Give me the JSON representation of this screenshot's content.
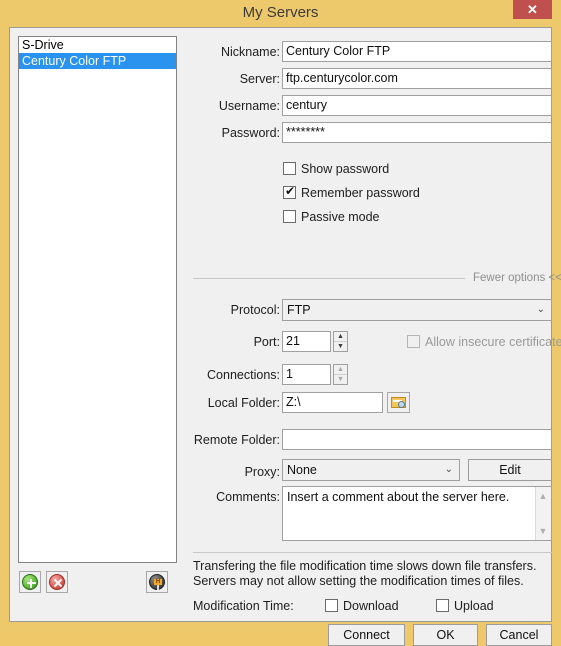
{
  "window": {
    "title": "My Servers",
    "close_label": "✕"
  },
  "server_list": {
    "items": [
      {
        "label": "S-Drive",
        "selected": false
      },
      {
        "label": "Century Color FTP",
        "selected": true
      }
    ]
  },
  "list_toolbar": {
    "add_tooltip": "Add",
    "delete_tooltip": "Delete",
    "options_tooltip": "Options"
  },
  "form": {
    "nickname": {
      "label": "Nickname:",
      "value": "Century Color FTP"
    },
    "server": {
      "label": "Server:",
      "value": "ftp.centurycolor.com"
    },
    "username": {
      "label": "Username:",
      "value": "century"
    },
    "password": {
      "label": "Password:",
      "value": "********"
    },
    "show_password": {
      "label": "Show password",
      "checked": false
    },
    "remember_password": {
      "label": "Remember password",
      "checked": true
    },
    "passive_mode": {
      "label": "Passive mode",
      "checked": false
    },
    "fewer_options": "Fewer options  <<",
    "protocol": {
      "label": "Protocol:",
      "value": "FTP"
    },
    "port": {
      "label": "Port:",
      "value": "21"
    },
    "allow_insecure_certificates": {
      "label": "Allow insecure certificates",
      "checked": false,
      "disabled": true
    },
    "connections": {
      "label": "Connections:",
      "value": "1"
    },
    "local_folder": {
      "label": "Local Folder:",
      "value": "Z:\\"
    },
    "browse_icon": "folder-browse-icon",
    "remote_folder": {
      "label": "Remote Folder:",
      "value": ""
    },
    "proxy": {
      "label": "Proxy:",
      "value": "None",
      "edit_label": "Edit"
    },
    "comments": {
      "label": "Comments:",
      "value": "Insert a comment about the server here."
    }
  },
  "footer": {
    "note": "Transfering the file modification time slows down file transfers. Servers may not allow setting the modification times of files.",
    "modification_time_label": "Modification Time:",
    "download": {
      "label": "Download",
      "checked": false
    },
    "upload": {
      "label": "Upload",
      "checked": false
    },
    "connect_label": "Connect",
    "ok_label": "OK",
    "cancel_label": "Cancel"
  },
  "icons": {
    "chevron_down": "⌄",
    "spin_up": "▲",
    "spin_down": "▼",
    "scroll_up": "▲",
    "scroll_down": "▼",
    "check": "✔",
    "add": "+",
    "remove": "×",
    "options": "H"
  },
  "colors": {
    "frame": "#eec96c",
    "client": "#f0f0f0",
    "close": "#c0504d",
    "selection": "#2a93ef",
    "add": "#5fbc3b",
    "remove": "#de6057"
  }
}
